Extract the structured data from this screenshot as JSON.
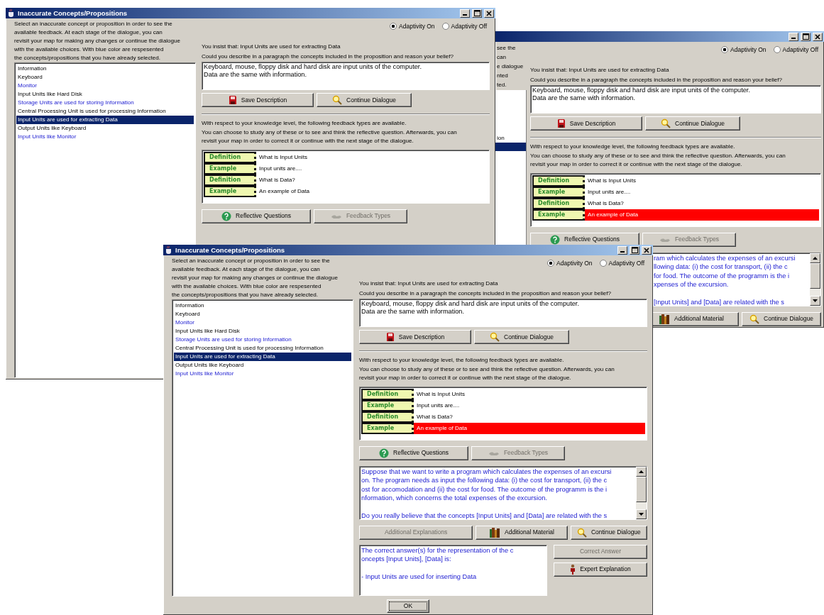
{
  "windows": [
    {
      "kind": "full",
      "title": "Inaccurate Concepts/Propositions",
      "instructions": [
        "Select an inaccurate concept or proposition in order to see the",
        "available feedback. At each stage of the dialogue, you can",
        "revisit your map for making any changes or continue the dialogue",
        "with the available choices. With blue color are respesented",
        " the concepts/propositions that you have already selected."
      ],
      "concepts": [
        {
          "text": "Information",
          "visited": false,
          "selected": false
        },
        {
          "text": "Keyboard",
          "visited": false,
          "selected": false
        },
        {
          "text": "Monitor",
          "visited": true,
          "selected": false
        },
        {
          "text": "Input Units like Hard Disk",
          "visited": false,
          "selected": false
        },
        {
          "text": "Storage Units are used for storing Information",
          "visited": true,
          "selected": false
        },
        {
          "text": "Central Processing Unit is used for processing Information",
          "visited": false,
          "selected": false
        },
        {
          "text": "Input Units are used for extracting Data",
          "visited": false,
          "selected": true
        },
        {
          "text": "Output Units like Keyboard",
          "visited": false,
          "selected": false
        },
        {
          "text": "Input Units like Monitor",
          "visited": true,
          "selected": false
        }
      ],
      "adaptivity": [
        {
          "label": "Adaptivity On",
          "selected": true
        },
        {
          "label": "Adaptivity Off",
          "selected": false
        }
      ],
      "insist": "You insist that:  Input Units are used for extracting Data",
      "prompt": "Could you describe in a paragraph the concepts included in the proposition and reason your belief?",
      "description": [
        "Keyboard, mouse, floppy disk and hard disk are input units of the computer.",
        "Data are the same with information."
      ],
      "description_buttons": [
        {
          "label": "Save Description",
          "kind": "save",
          "disabled": false
        },
        {
          "label": "Continue Dialogue",
          "kind": "continue",
          "disabled": false
        }
      ],
      "feedback_intro": [
        "With respect to your knowledge level, the following feedback types are available.",
        "You can choose to study any of these or to see and think the reflective question. Afterwards, you can",
        "revisit your map in order to correct it or continue with the next stage of the dialogue."
      ],
      "feedback_items": [
        {
          "type": "Definition",
          "text": "What is Input Units",
          "selected": false
        },
        {
          "type": "Example",
          "text": "Input units are....",
          "selected": false
        },
        {
          "type": "Definition",
          "text": "What is Data?",
          "selected": false
        },
        {
          "type": "Example",
          "text": "An example of Data",
          "selected": false
        }
      ],
      "feedback_buttons": [
        {
          "label": "Reflective Questions",
          "kind": "reflective",
          "disabled": false
        },
        {
          "label": "Feedback Types",
          "kind": "feedback",
          "disabled": true
        }
      ]
    },
    {
      "kind": "partial",
      "instruction_fragments": [
        "see the",
        "can",
        "e dialogue",
        "nted",
        "ted."
      ],
      "concept_fragments": [
        {
          "selected": false
        },
        {
          "selected": false
        },
        {
          "selected": false
        },
        {
          "selected": false
        },
        {
          "selected": false
        },
        {
          "text": "ion",
          "selected": false
        },
        {
          "selected": true
        },
        {
          "selected": false
        },
        {
          "selected": false
        }
      ],
      "adaptivity": [
        {
          "label": "Adaptivity On",
          "selected": true
        },
        {
          "label": "Adaptivity Off",
          "selected": false
        }
      ],
      "insist": "You insist that:  Input Units are used for extracting Data",
      "prompt": "Could you describe in a paragraph the concepts included in the proposition and reason your belief?",
      "description": [
        "Keyboard, mouse, floppy disk and hard disk are input units of the computer.",
        "Data are the same with information."
      ],
      "description_buttons": [
        {
          "label": "Save Description",
          "kind": "save",
          "disabled": false
        },
        {
          "label": "Continue Dialogue",
          "kind": "continue",
          "disabled": false
        }
      ],
      "feedback_intro": [
        "With respect to your knowledge level, the following feedback types are available.",
        "You can choose to study any of these or to see and think the reflective question. Afterwards, you can",
        "revisit your map in order to correct it or continue with the next stage of the dialogue."
      ],
      "feedback_items": [
        {
          "type": "Definition",
          "text": "What is Input Units",
          "selected": false
        },
        {
          "type": "Example",
          "text": "Input units are....",
          "selected": false
        },
        {
          "type": "Definition",
          "text": "What is Data?",
          "selected": false
        },
        {
          "type": "Example",
          "text": "An example of Data",
          "selected": true
        }
      ],
      "feedback_buttons": [
        {
          "label": "Reflective Questions",
          "kind": "reflective",
          "disabled": false
        },
        {
          "label": "Feedback Types",
          "kind": "feedback",
          "disabled": true
        }
      ],
      "question": [
        [
          "ram which calculates the expenses of an excursi",
          "llowing data: (i) the cost for transport, (ii) the c",
          "for food. The outcome of the programm is the i",
          "xpenses of the excursion."
        ],
        [
          "[Input Units] and [Data] are related with the s"
        ]
      ],
      "question_buttons": [
        {
          "label": "Additional Material",
          "kind": "material",
          "disabled": false
        },
        {
          "label": "Continue Dialogue",
          "kind": "continue",
          "disabled": false
        }
      ]
    },
    {
      "kind": "full",
      "title": "Inaccurate Concepts/Propositions",
      "instructions": [
        "Select an inaccurate concept or proposition in order to see the",
        "available feedback. At each stage of the dialogue, you can",
        "revisit your map for making any changes or continue the dialogue",
        "with the available choices. With blue color are respesented",
        " the concepts/propositions that you have already selected."
      ],
      "concepts": [
        {
          "text": "Information",
          "visited": false,
          "selected": false
        },
        {
          "text": "Keyboard",
          "visited": false,
          "selected": false
        },
        {
          "text": "Monitor",
          "visited": true,
          "selected": false
        },
        {
          "text": "Input Units like Hard Disk",
          "visited": false,
          "selected": false
        },
        {
          "text": "Storage Units are used for storing Information",
          "visited": true,
          "selected": false
        },
        {
          "text": "Central Processing Unit is used for processing Information",
          "visited": false,
          "selected": false
        },
        {
          "text": "Input Units are used for extracting Data",
          "visited": false,
          "selected": true
        },
        {
          "text": "Output Units like Keyboard",
          "visited": false,
          "selected": false
        },
        {
          "text": "Input Units like Monitor",
          "visited": true,
          "selected": false
        }
      ],
      "adaptivity": [
        {
          "label": "Adaptivity On",
          "selected": true
        },
        {
          "label": "Adaptivity Off",
          "selected": false
        }
      ],
      "insist": "You insist that:  Input Units are used for extracting Data",
      "prompt": "Could you describe in a paragraph the concepts included in the proposition and reason your belief?",
      "description": [
        "Keyboard, mouse, floppy disk and hard disk are input units of the computer.",
        "Data are the same with information."
      ],
      "description_buttons": [
        {
          "label": "Save Description",
          "kind": "save",
          "disabled": false
        },
        {
          "label": "Continue Dialogue",
          "kind": "continue",
          "disabled": false
        }
      ],
      "feedback_intro": [
        "With respect to your knowledge level, the following feedback types are available.",
        "You can choose to study any of these or to see and think the reflective question. Afterwards, you can",
        "revisit your map in order to correct it or continue with the next stage of the dialogue."
      ],
      "feedback_items": [
        {
          "type": "Definition",
          "text": "What is Input Units",
          "selected": false
        },
        {
          "type": "Example",
          "text": "Input units are....",
          "selected": false
        },
        {
          "type": "Definition",
          "text": "What is Data?",
          "selected": false
        },
        {
          "type": "Example",
          "text": "An example of Data",
          "selected": true
        }
      ],
      "feedback_buttons": [
        {
          "label": "Reflective Questions",
          "kind": "reflective",
          "disabled": false
        },
        {
          "label": "Feedback Types",
          "kind": "feedback",
          "disabled": true
        }
      ],
      "question": [
        [
          "Suppose that we want to write a program which calculates the expenses of an excursi",
          "on. The program needs as input the following data: (i) the cost for transport, (ii) the c",
          "ost for accomodation and (ii) the cost for food. The outcome of the programm is the i",
          "nformation, which concerns the total expenses of the excursion."
        ],
        [
          "Do you really believe that the concepts [Input Units] and [Data] are related with the s"
        ]
      ],
      "question_buttons": [
        {
          "label": "Additional Explanations",
          "kind": "explanations",
          "disabled": true
        },
        {
          "label": "Additional Material",
          "kind": "material",
          "disabled": false
        },
        {
          "label": "Continue Dialogue",
          "kind": "continue",
          "disabled": false
        }
      ],
      "answer": [
        [
          "The correct answer(s) for the representation of the c",
          "oncepts [Input Units], [Data] is:"
        ],
        [
          "- Input Units are used for inserting Data"
        ]
      ],
      "answer_buttons": [
        {
          "label": "Correct Answer",
          "kind": "answer",
          "disabled": true
        },
        {
          "label": "Expert Explanation",
          "kind": "expert",
          "disabled": false
        }
      ],
      "ok": {
        "label": "OK",
        "kind": "ok",
        "disabled": false
      }
    }
  ]
}
